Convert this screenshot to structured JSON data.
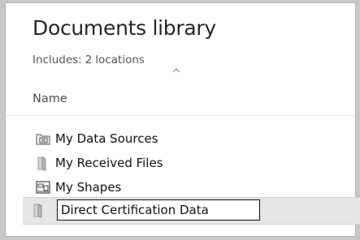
{
  "library": {
    "title": "Documents library",
    "includes_label": "Includes:",
    "includes_count": "2",
    "includes_unit": "locations"
  },
  "columns": {
    "name_header": "Name",
    "sort_icon": "sort-ascending-icon"
  },
  "items": [
    {
      "label": "My Data Sources",
      "icon": "data-sources-folder-icon"
    },
    {
      "label": "My Received Files",
      "icon": "folder-icon"
    },
    {
      "label": "My Shapes",
      "icon": "shapes-folder-icon"
    }
  ],
  "renaming_item": {
    "value": "Direct Certification Data",
    "icon": "folder-icon"
  }
}
